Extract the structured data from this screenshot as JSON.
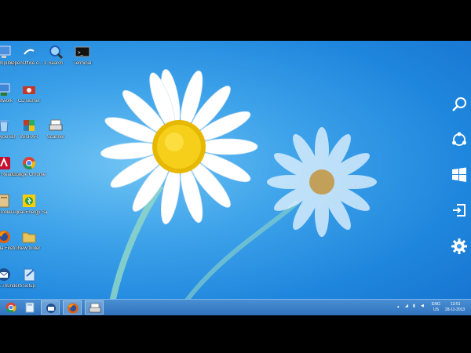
{
  "desktop": {
    "icons": [
      {
        "label": "Computer",
        "icon": "computer-icon"
      },
      {
        "label": "OpenOffice.o... 3.3",
        "icon": "openoffice-icon"
      },
      {
        "label": "Search",
        "icon": "search-icon"
      },
      {
        "label": "Terminal",
        "icon": "terminal-icon"
      },
      {
        "label": "Network",
        "icon": "network-icon"
      },
      {
        "label": "CD Burner",
        "icon": "cd-burner-icon"
      },
      {
        "label": "Recycle Bin",
        "icon": "recycle-bin-icon"
      },
      {
        "label": "WinRAR",
        "icon": "winrar-icon"
      },
      {
        "label": "Scanner",
        "icon": "scanner-icon"
      },
      {
        "label": "Adobe Reader X",
        "icon": "adobe-reader-icon"
      },
      {
        "label": "Google Chrome",
        "icon": "chrome-icon"
      },
      {
        "label": "Profile",
        "icon": "profile-icon"
      },
      {
        "label": "Digital Energy Saver",
        "icon": "energy-saver-icon"
      },
      {
        "label": "Mozilla Firefox",
        "icon": "firefox-icon"
      },
      {
        "label": "New folder",
        "icon": "folder-icon"
      },
      {
        "label": "Mozilla Thunderbird",
        "icon": "thunderbird-icon"
      },
      {
        "label": "Setup",
        "icon": "setup-icon"
      }
    ]
  },
  "charms": [
    "search-charm-icon",
    "share-charm-icon",
    "start-charm-icon",
    "devices-charm-icon",
    "settings-charm-icon"
  ],
  "taskbar": {
    "pinned": [
      "chrome-icon",
      "files-icon",
      "thunderbird-icon",
      "firefox-icon",
      "scanner-icon"
    ],
    "tray": {
      "lang": "ENG",
      "region": "US",
      "time": "12:51",
      "date": "28-11-2013"
    }
  },
  "colors": {
    "accent": "#2f73bf",
    "wallpaper": "#3ea3ea"
  }
}
